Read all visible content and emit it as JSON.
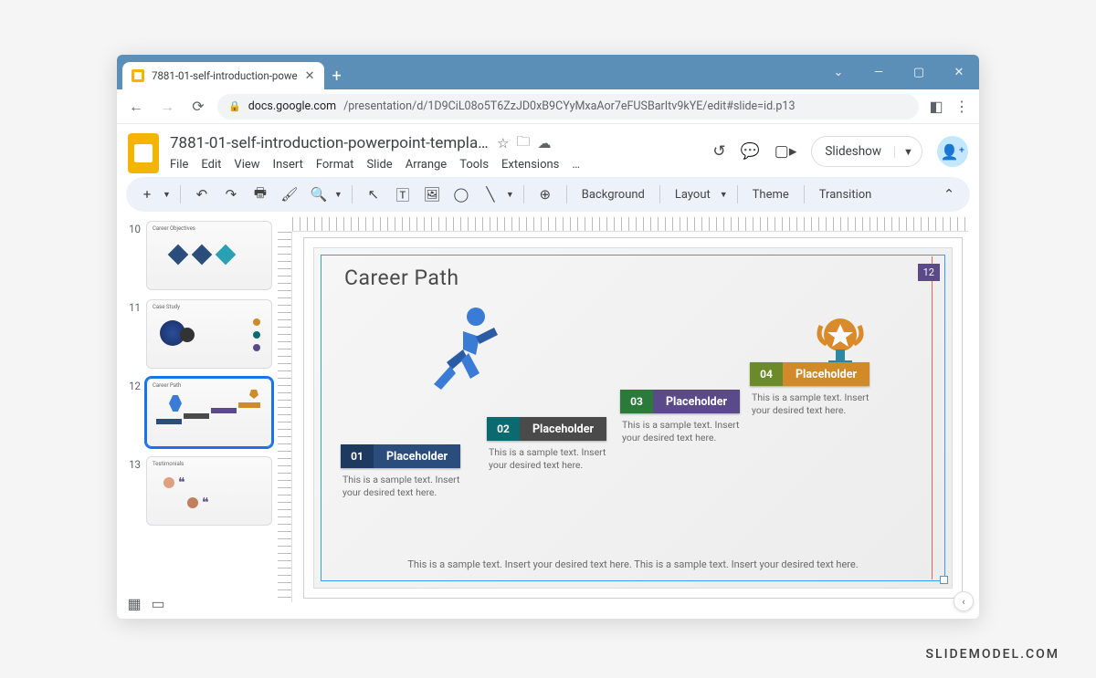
{
  "browser": {
    "tab_title": "7881-01-self-introduction-powe",
    "url_host": "docs.google.com",
    "url_path": "/presentation/d/1D9CiL08o5T6ZzJD0xB9CYyMxaAor7eFUSBarItv9kYE/edit#slide=id.p13"
  },
  "header": {
    "doc_title": "7881-01-self-introduction-powerpoint-templat...",
    "menus": [
      "File",
      "Edit",
      "View",
      "Insert",
      "Format",
      "Slide",
      "Arrange",
      "Tools",
      "Extensions",
      "…"
    ],
    "slideshow_label": "Slideshow"
  },
  "toolbar": {
    "items": [
      "Background",
      "Layout",
      "Theme",
      "Transition"
    ]
  },
  "thumbs": [
    {
      "num": "10",
      "caption": "Career Objectives"
    },
    {
      "num": "11",
      "caption": "Case Study"
    },
    {
      "num": "12",
      "caption": "Career Path",
      "selected": true
    },
    {
      "num": "13",
      "caption": "Testimonials"
    }
  ],
  "slide": {
    "number": "12",
    "title": "Career Path",
    "steps": [
      {
        "num": "01",
        "label": "Placeholder",
        "desc": "This is a sample text. Insert your desired text here."
      },
      {
        "num": "02",
        "label": "Placeholder",
        "desc": "This is a sample text. Insert your desired text here."
      },
      {
        "num": "03",
        "label": "Placeholder",
        "desc": "This is a sample text. Insert your desired text here."
      },
      {
        "num": "04",
        "label": "Placeholder",
        "desc": "This is a sample text. Insert your desired text here."
      }
    ],
    "footer": "This is a sample text. Insert your desired text here. This is a sample text. Insert your desired text here."
  },
  "watermark": "SLIDEMODEL.COM"
}
